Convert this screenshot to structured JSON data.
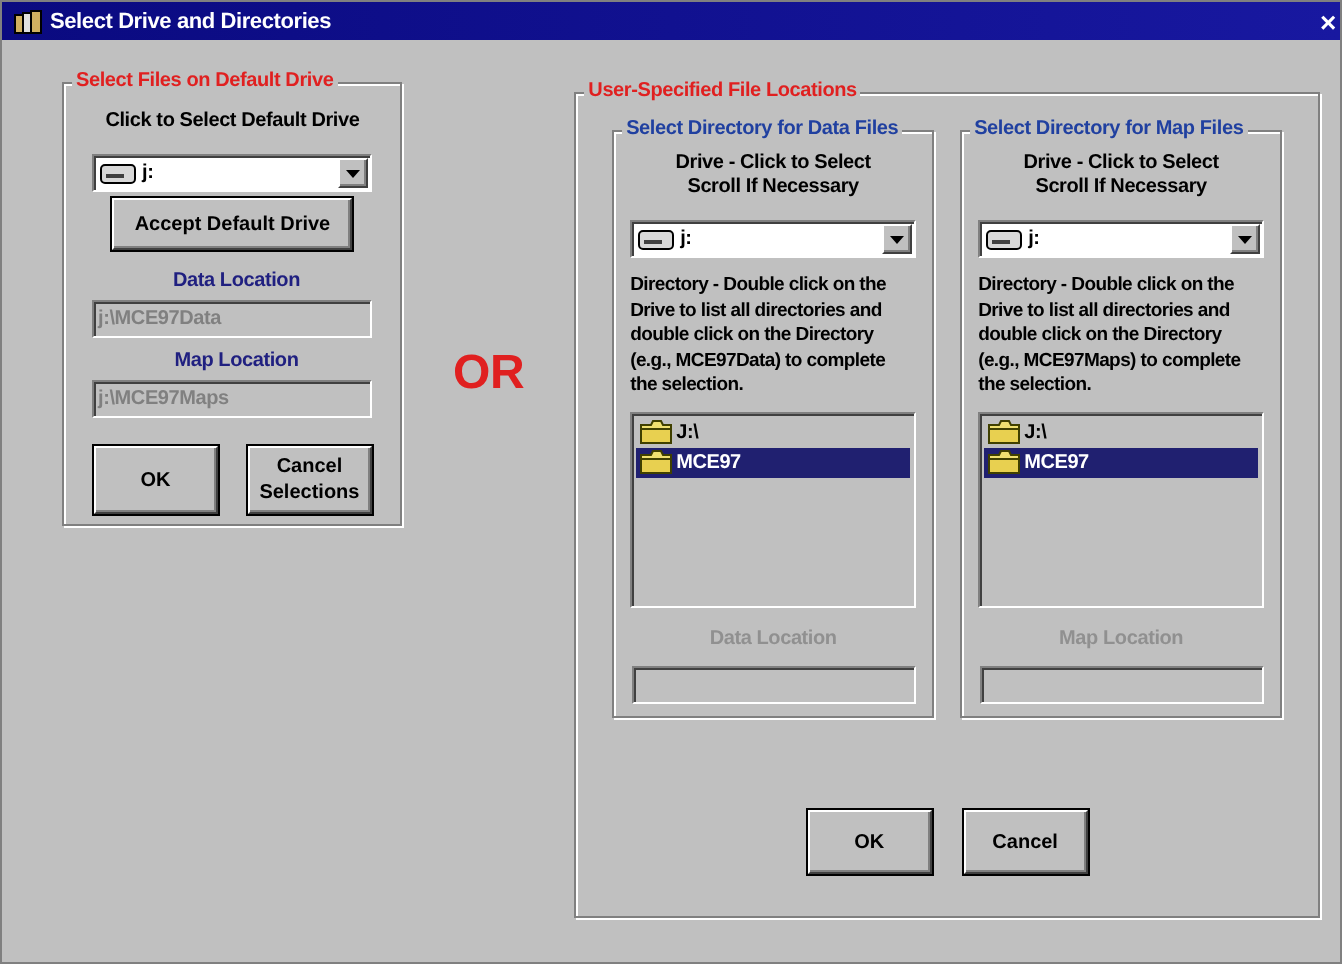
{
  "window": {
    "title": "Select Drive and Directories",
    "close": "×"
  },
  "default_drive": {
    "title": "Select Files on Default Drive",
    "prompt": "Click to Select Default Drive",
    "drive": "j:",
    "accept_button": "Accept Default Drive",
    "locations": [
      {
        "label": "Data Location",
        "value": "j:\\MCE97Data",
        "disabled": true
      },
      {
        "label": "Map Location",
        "value": "j:\\MCE97Maps",
        "disabled": true
      }
    ],
    "buttons": [
      "OK",
      "Cancel Selections"
    ]
  },
  "or_label": "OR",
  "user_specified": {
    "title": "User-Specified File Locations",
    "panels": [
      {
        "title": "Select Directory for Data Files",
        "prompt": [
          "Drive - Click to Select",
          "Scroll If Necessary"
        ],
        "drive": "j:",
        "help": "Directory - Double click on the Drive to list all directories and double click on the Directory (e.g., MCE97Data) to complete the selection.",
        "directories": [
          {
            "name": "J:\\",
            "selected": false
          },
          {
            "name": "MCE97",
            "selected": true
          }
        ],
        "location": {
          "label": "Data Location",
          "disabled": true
        }
      },
      {
        "title": "Select Directory for Map Files",
        "prompt": [
          "Drive - Click to Select",
          "Scroll If Necessary"
        ],
        "drive": "j:",
        "help": "Directory - Double click on the Drive to list all directories and double click on the Directory (e.g., MCE97Maps) to complete the selection.",
        "directories": [
          {
            "name": "J:\\",
            "selected": false
          },
          {
            "name": "MCE97",
            "selected": true
          }
        ],
        "location": {
          "label": "Map Location",
          "disabled": true
        }
      }
    ],
    "buttons": [
      "OK",
      "Cancel"
    ]
  }
}
